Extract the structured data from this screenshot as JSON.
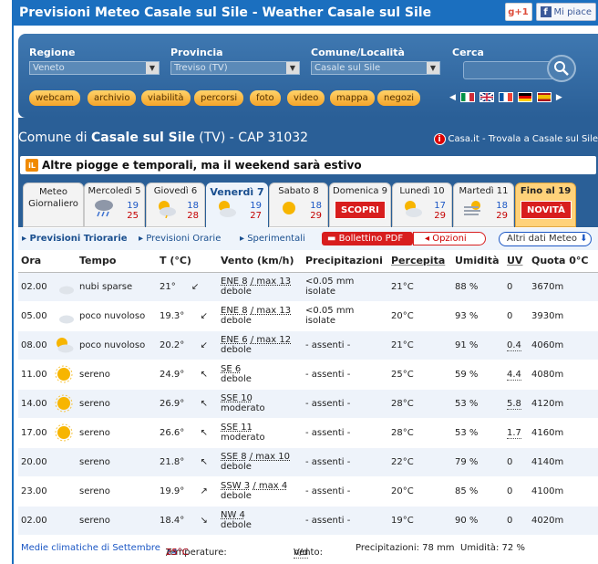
{
  "title": "Previsioni Meteo Casale sul Sile - Weather Casale sul Sile",
  "social": {
    "gplus": "+1",
    "fb": "Mi piace"
  },
  "search": {
    "labels": [
      "Regione",
      "Provincia",
      "Comune/Località",
      "Cerca"
    ],
    "regione": "Veneto",
    "provincia": "Treviso (TV)",
    "comune": "Casale sul Sile"
  },
  "buttons": [
    "webcam",
    "archivio",
    "viabilità",
    "percorsi",
    "foto",
    "video",
    "mappa",
    "negozi"
  ],
  "header": {
    "prefix": "Comune di ",
    "town": "Casale sul Sile",
    "suffix": " (TV) - CAP 31032",
    "casa_link": "Casa.it - Trovala a Casale sul Sile"
  },
  "alert": "Altre piogge e temporali, ma il weekend sarà estivo",
  "tabs": [
    {
      "name": "Meteo Giornaliero"
    },
    {
      "name": "Mercoledì 5",
      "min": "19",
      "max": "25",
      "icon": "rain-icon"
    },
    {
      "name": "Giovedì 6",
      "min": "18",
      "max": "28",
      "icon": "partly-cloudy-icon"
    },
    {
      "name": "Venerdì 7",
      "min": "19",
      "max": "27",
      "icon": "sun-cloud-icon"
    },
    {
      "name": "Sabato 8",
      "min": "18",
      "max": "29",
      "icon": "sun-icon"
    },
    {
      "name": "Domenica 9",
      "badge": "SCOPRI"
    },
    {
      "name": "Lunedì 10",
      "min": "17",
      "max": "29",
      "icon": "sun-cloud-icon"
    },
    {
      "name": "Martedì 11",
      "min": "18",
      "max": "29",
      "icon": "fog-icon"
    },
    {
      "name": "Fino al 19",
      "badge": "NOVITÀ"
    }
  ],
  "subnav": {
    "triorarie": "Previsioni Triorarie",
    "orarie": "Previsioni Orarie",
    "sperimentali": "Sperimentali",
    "pdf": "Bollettino PDF",
    "opzioni": "Opzioni",
    "altri": "Altri dati Meteo"
  },
  "columns": [
    "Ora",
    "Tempo",
    "T (°C)",
    "Vento (km/h)",
    "Precipitazioni",
    "Percepita",
    "Umidità",
    "UV",
    "Quota 0°C"
  ],
  "rows": [
    {
      "ora": "02.00",
      "icon": "moon-cloud-icon",
      "tempo": "nubi sparse",
      "t": "21°",
      "vento": "ENE 8",
      "max": "/ max 13",
      "forza": "debole",
      "precip": "<0.05 mm",
      "precip2": "isolate",
      "perc": "21°C",
      "umid": "88 %",
      "uv": "0",
      "quota": "3670m"
    },
    {
      "ora": "05.00",
      "icon": "moon-cloud-icon",
      "tempo": "poco nuvoloso",
      "t": "19.3°",
      "vento": "ENE 8",
      "max": "/ max 13",
      "forza": "debole",
      "precip": "<0.05 mm",
      "precip2": "isolate",
      "perc": "20°C",
      "umid": "93 %",
      "uv": "0",
      "quota": "3930m"
    },
    {
      "ora": "08.00",
      "icon": "sun-cloud-icon",
      "tempo": "poco nuvoloso",
      "t": "20.2°",
      "vento": "ENE 6",
      "max": "/ max 12",
      "forza": "debole",
      "precip": "- assenti -",
      "precip2": "",
      "perc": "21°C",
      "umid": "91 %",
      "uv": "0.4",
      "quota": "4060m"
    },
    {
      "ora": "11.00",
      "icon": "sun-icon",
      "tempo": "sereno",
      "t": "24.9°",
      "vento": "SE 6",
      "max": "",
      "forza": "debole",
      "precip": "- assenti -",
      "precip2": "",
      "perc": "25°C",
      "umid": "59 %",
      "uv": "4.4",
      "quota": "4080m"
    },
    {
      "ora": "14.00",
      "icon": "sun-icon",
      "tempo": "sereno",
      "t": "26.9°",
      "vento": "SSE 10",
      "max": "",
      "forza": "moderato",
      "precip": "- assenti -",
      "precip2": "",
      "perc": "28°C",
      "umid": "53 %",
      "uv": "5.8",
      "quota": "4120m"
    },
    {
      "ora": "17.00",
      "icon": "sun-icon",
      "tempo": "sereno",
      "t": "26.6°",
      "vento": "SSE 11",
      "max": "",
      "forza": "moderato",
      "precip": "- assenti -",
      "precip2": "",
      "perc": "28°C",
      "umid": "53 %",
      "uv": "1.7",
      "quota": "4160m"
    },
    {
      "ora": "20.00",
      "icon": "moon-icon",
      "tempo": "sereno",
      "t": "21.8°",
      "vento": "SSE 8",
      "max": "/ max 10",
      "forza": "debole",
      "precip": "- assenti -",
      "precip2": "",
      "perc": "22°C",
      "umid": "79 %",
      "uv": "0",
      "quota": "4140m"
    },
    {
      "ora": "23.00",
      "icon": "moon-icon",
      "tempo": "sereno",
      "t": "19.9°",
      "vento": "SSW 3",
      "max": "/ max 4",
      "forza": "debole",
      "precip": "- assenti -",
      "precip2": "",
      "perc": "20°C",
      "umid": "85 %",
      "uv": "0",
      "quota": "4100m"
    },
    {
      "ora": "02.00",
      "icon": "moon-icon",
      "tempo": "sereno",
      "t": "18.4°",
      "vento": "NW 4",
      "max": "",
      "forza": "debole",
      "precip": "- assenti -",
      "precip2": "",
      "perc": "19°C",
      "umid": "90 %",
      "uv": "0",
      "quota": "4020m"
    }
  ],
  "footer": {
    "medie": "Medie climatiche di Settembre",
    "temp_label": "Temperature:",
    "tmin": "14°C",
    "sep": " / ",
    "tmax": "25°C",
    "vento_label": "Vento:",
    "vento": "n/d",
    "precip": "Precipitazioni: 78 mm",
    "umid": "Umidità: 72 %"
  }
}
